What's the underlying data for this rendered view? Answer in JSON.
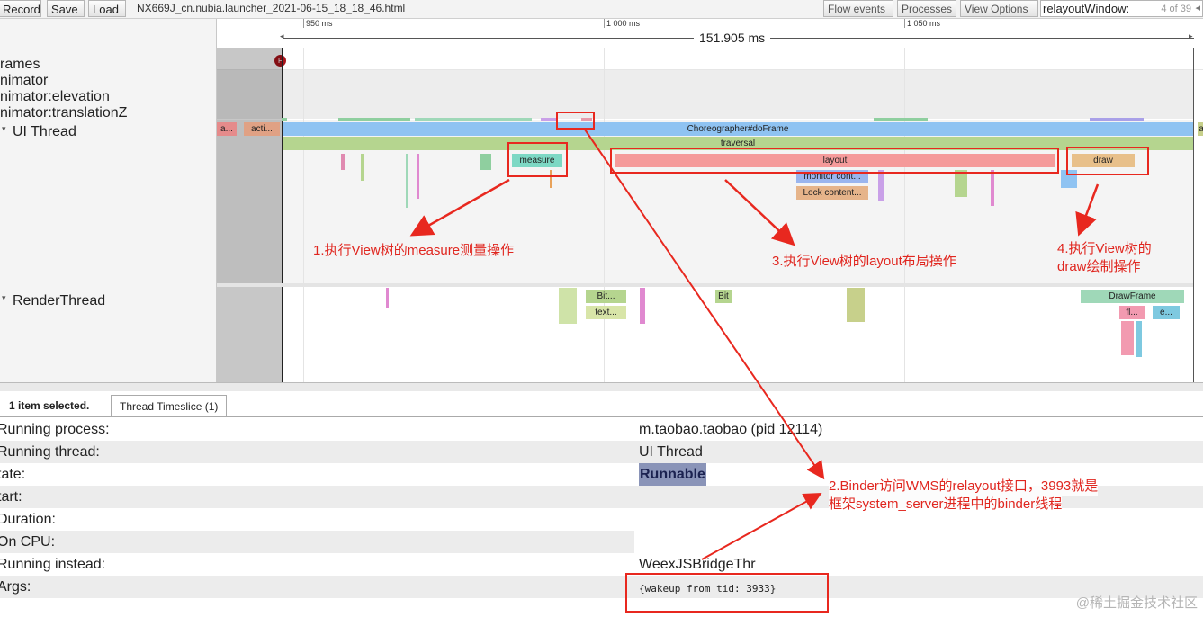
{
  "toolbar": {
    "record": "Record",
    "save": "Save",
    "load": "Load",
    "file_title": "NX669J_cn.nubia.launcher_2021-06-15_18_18_46.html",
    "flow_events": "Flow events",
    "processes": "Processes",
    "view_options": "View Options",
    "search_value": "relayoutWindow:",
    "search_count": "4 of 39"
  },
  "tracks": {
    "labels": [
      "rames",
      "nimator",
      "nimator:elevation",
      "nimator:translationZ",
      "UI Thread",
      "RenderThread"
    ]
  },
  "ruler": {
    "ticks": [
      "950 ms",
      "1 000 ms",
      "1 050 ms"
    ],
    "span": "151.905 ms"
  },
  "frame_marker": "F",
  "slices": {
    "choreographer": "Choreographer#doFrame",
    "traversal": "traversal",
    "measure": "measure",
    "layout": "layout",
    "draw": "draw",
    "monitor": "monitor cont...",
    "lock": "Lock content...",
    "small_a": "a...",
    "small_acti": "acti...",
    "small_a2": "a",
    "bit1": "Bit...",
    "text1": "text...",
    "bit2": "Bit",
    "drawframe": "DrawFrame",
    "fl": "fl...",
    "e": "e..."
  },
  "annotations": {
    "a1": "1.执行View树的measure测量操作",
    "a3": "3.执行View树的layout布局操作",
    "a4_l1": "4.执行View树的",
    "a4_l2": "draw绘制操作",
    "a2_l1": "2.Binder访问WMS的relayout接口，3993就是",
    "a2_l2": "框架system_server进程中的binder线程"
  },
  "analysis": {
    "selected": "1 item selected.",
    "tab": "Thread Timeslice (1)",
    "rows": [
      {
        "key": "Running process:",
        "value": "m.taobao.taobao (pid 12114)"
      },
      {
        "key": "Running thread:",
        "value": "UI Thread"
      },
      {
        "key": "tate:",
        "value": "Runnable"
      },
      {
        "key": "tart:",
        "value": ""
      },
      {
        "key": "Duration:",
        "value": ""
      },
      {
        "key": "On CPU:",
        "value": ""
      },
      {
        "key": "Running instead:",
        "value": "WeexJSBridgeThr"
      },
      {
        "key": "Args:",
        "value": "{wakeup from tid: 3933}"
      }
    ]
  },
  "watermark": "@稀土掘金技术社区",
  "colors": {
    "accent_red": "#e8281f",
    "choreographer": "#8fc3f2",
    "traversal": "#b5d58f",
    "measure": "#7dd8c4",
    "layout": "#f59a9a",
    "draw": "#e8c08a",
    "state_highlight": "#8a94b8"
  }
}
